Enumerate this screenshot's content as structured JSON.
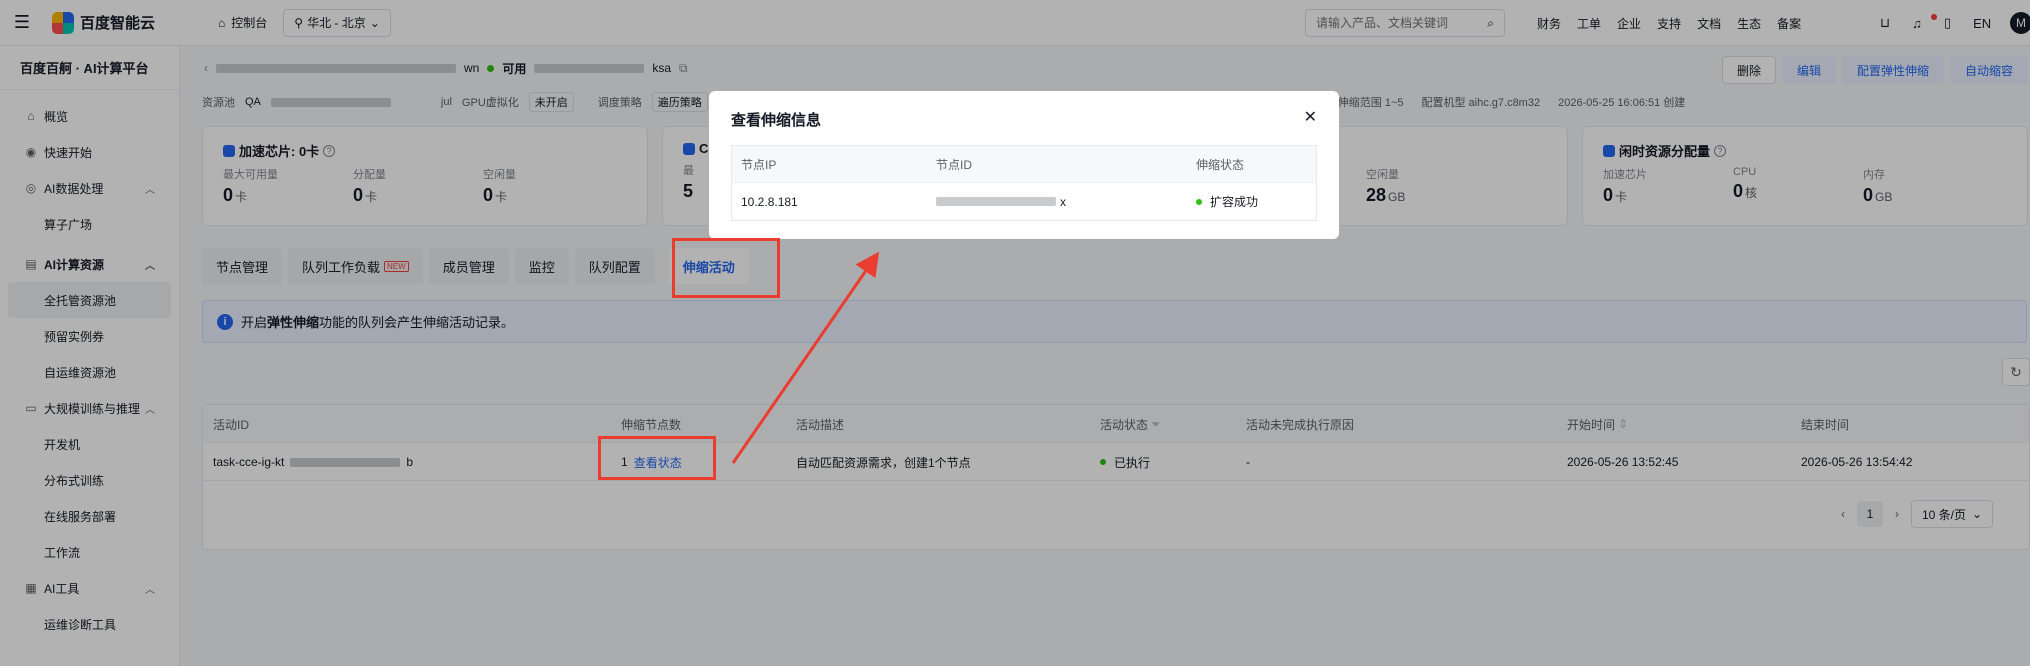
{
  "topbar": {
    "logo": "百度智能云",
    "console": "控制台",
    "region": "华北 - 北京",
    "search_placeholder": "请输入产品、文档关键词",
    "nav": [
      "财务",
      "工单",
      "企业",
      "支持",
      "文档",
      "生态",
      "备案"
    ],
    "avatar": "M",
    "lang": "EN"
  },
  "sidebar": {
    "title": "百度百舸 · AI计算平台",
    "items": [
      {
        "label": "概览",
        "icon": "home-icon"
      },
      {
        "label": "快速开始",
        "icon": "rocket-icon"
      },
      {
        "label": "AI数据处理",
        "icon": "data-icon"
      },
      {
        "label": "算子广场"
      },
      {
        "label": "AI计算资源",
        "icon": "server-icon"
      },
      {
        "label": "全托管资源池"
      },
      {
        "label": "预留实例券"
      },
      {
        "label": "自运维资源池"
      },
      {
        "label": "大规模训练与推理",
        "icon": "monitor-icon"
      },
      {
        "label": "开发机"
      },
      {
        "label": "分布式训练"
      },
      {
        "label": "在线服务部署"
      },
      {
        "label": "工作流"
      },
      {
        "label": "AI工具",
        "icon": "grid-icon"
      },
      {
        "label": "运维诊断工具"
      }
    ]
  },
  "header": {
    "name_suffix": "wn",
    "status": "可用",
    "id_suffix": "ksa",
    "buttons": [
      "删除",
      "编辑",
      "配置弹性伸缩",
      "自动缩容"
    ]
  },
  "meta": {
    "pool_label": "资源池",
    "pool_prefix": "QA",
    "pool_suffix": "jul",
    "gpu_label": "GPU虚拟化",
    "gpu_value": "未开启",
    "sched_label": "调度策略",
    "sched_value": "遍历策略",
    "scale_range": "伸缩范围  1~5",
    "machine_type": "配置机型  aihc.g7.c8m32",
    "created": "2026-05-25 16:06:51 创建"
  },
  "cards": [
    {
      "title": "加速芯片: 0卡",
      "stats": [
        {
          "label": "最大可用量",
          "value": "0",
          "unit": "卡"
        },
        {
          "label": "分配量",
          "value": "0",
          "unit": "卡"
        },
        {
          "label": "空闲量",
          "value": "0",
          "unit": "卡"
        }
      ]
    },
    {
      "title": "C",
      "stats": [
        {
          "label": "最",
          "value": "5",
          "unit": ""
        }
      ]
    },
    {
      "title": "",
      "stats": [
        {
          "label": "空闲量",
          "value": "28",
          "unit": "GB"
        }
      ]
    },
    {
      "title": "闲时资源分配量",
      "stats": [
        {
          "label": "加速芯片",
          "value": "0",
          "unit": "卡"
        },
        {
          "label": "CPU",
          "value": "0",
          "unit": "核"
        },
        {
          "label": "内存",
          "value": "0",
          "unit": "GB"
        }
      ]
    }
  ],
  "tabs": [
    {
      "label": "节点管理"
    },
    {
      "label": "队列工作负载",
      "badge": "NEW"
    },
    {
      "label": "成员管理"
    },
    {
      "label": "监控"
    },
    {
      "label": "队列配置"
    },
    {
      "label": "伸缩活动"
    }
  ],
  "alert": {
    "prefix": "开启",
    "bold": "弹性伸缩",
    "suffix": "功能的队列会产生伸缩活动记录。"
  },
  "table": {
    "headers": [
      "活动ID",
      "伸缩节点数",
      "活动描述",
      "活动状态",
      "活动未完成执行原因",
      "开始时间",
      "结束时间"
    ],
    "rows": [
      {
        "id_prefix": "task-cce-ig-kt",
        "id_suffix": "b",
        "count": "1",
        "action": "查看状态",
        "desc": "自动匹配资源需求，创建1个节点",
        "status": "已执行",
        "reason": "-",
        "start": "2026-05-26 13:52:45",
        "end": "2026-05-26 13:54:42"
      }
    ]
  },
  "pagination": {
    "current": "1",
    "page_size": "10 条/页"
  },
  "modal": {
    "title": "查看伸缩信息",
    "headers": [
      "节点IP",
      "节点ID",
      "伸缩状态"
    ],
    "rows": [
      {
        "ip": "10.2.8.181",
        "id_suffix": "x",
        "status": "扩容成功"
      }
    ]
  },
  "colors": {
    "accent": "#2468f2",
    "success": "#30bf13",
    "annotation": "#ea3d2f"
  }
}
